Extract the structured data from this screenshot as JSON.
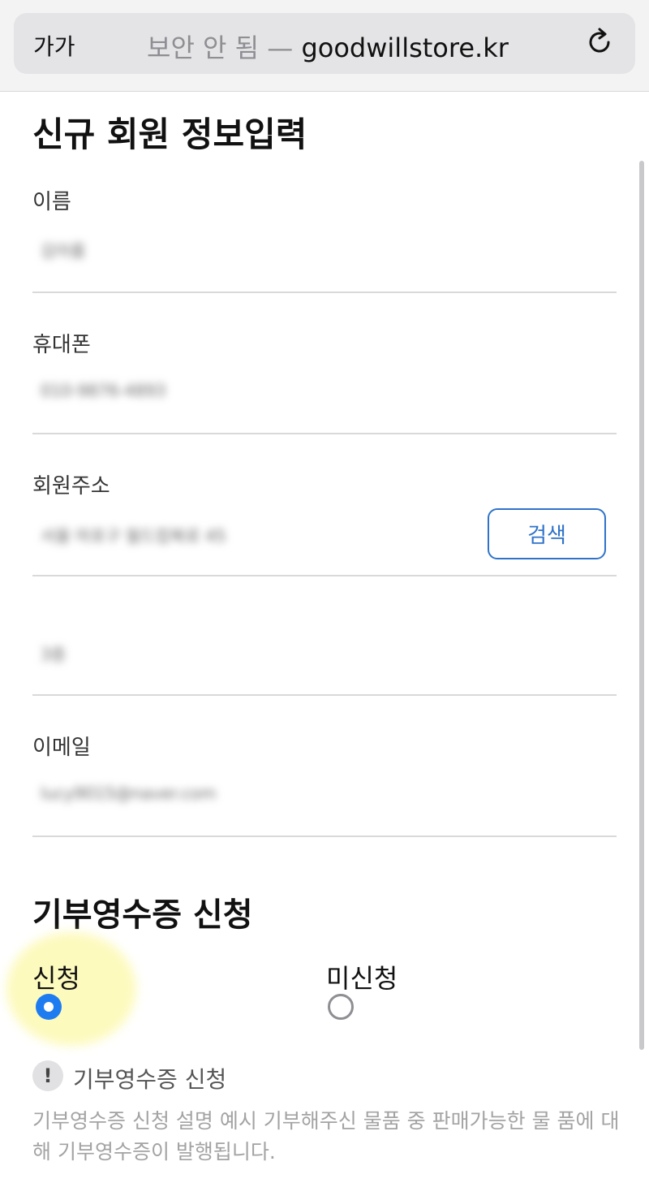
{
  "browser": {
    "text_size_label": "가가",
    "url_prefix": "보안 안 됨 — ",
    "url_host": "goodwillstore.kr",
    "reload_icon": "reload-icon"
  },
  "form": {
    "title": "신규 회원 정보입력",
    "fields": [
      {
        "label": "이름",
        "value": "김아름"
      },
      {
        "label": "휴대폰",
        "value": "010-9876-4893"
      },
      {
        "label": "회원주소",
        "value": "서울 마포구 월드컵북로 45"
      },
      {
        "label": "",
        "value": "3층"
      },
      {
        "label": "이메일",
        "value": "lucy9015@naver.com"
      }
    ],
    "search_button_label": "검색"
  },
  "receipt": {
    "title": "기부영수증 신청",
    "options": [
      {
        "label": "신청",
        "selected": true
      },
      {
        "label": "미신청",
        "selected": false
      }
    ],
    "notice_icon_glyph": "!",
    "notice_title": "기부영수증 신청",
    "notice_description": "기부영수증 신청 설명 예시 기부해주신 물품 중 판매가능한 물 품에 대해 기부영수증이 발행됩니다."
  },
  "colors": {
    "accent": "#2f73c9",
    "radio_selected": "#1f7cf0",
    "highlight": "#faf56e"
  }
}
